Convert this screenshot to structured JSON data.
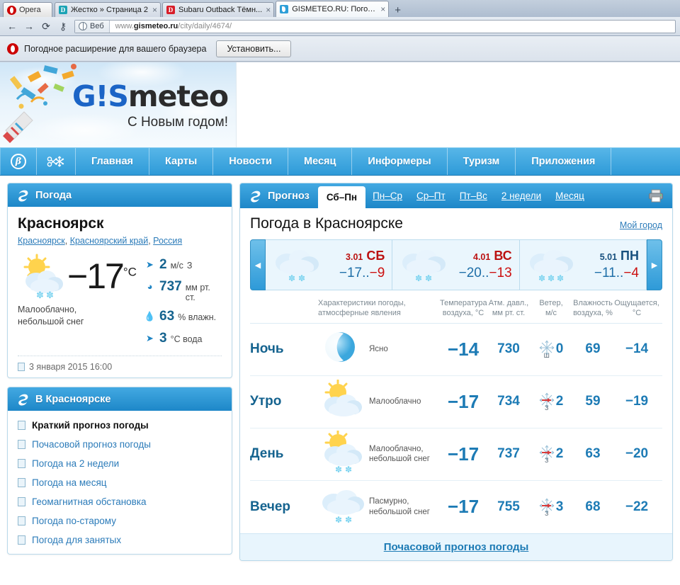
{
  "browser": {
    "opera_label": "Opera",
    "tabs": [
      {
        "title": "Жестко » Страница 2",
        "favicon": "letter-d-teal",
        "active": false
      },
      {
        "title": "Subaru Outback Тёмн...",
        "favicon": "letter-d-red",
        "active": false
      },
      {
        "title": "GISMETEO.RU: Погода ...",
        "favicon": "gismeteo-drop",
        "active": true
      }
    ],
    "new_tab_label": "+",
    "toolbar": {
      "back_icon": "arrow-left-icon",
      "forward_icon": "arrow-right-icon",
      "reload_icon": "reload-icon",
      "key_icon": "key-icon",
      "scope_label": "Веб",
      "scope_icon": "globe-icon",
      "url_prefix": "www.",
      "url_domain": "gismeteo.ru",
      "url_path": "/city/daily/4674/"
    }
  },
  "notification": {
    "icon": "opera-logo-icon",
    "text": "Погодное расширение для вашего браузера",
    "button_label": "Установить..."
  },
  "site": {
    "logo_g": "G",
    "logo_bang": "!",
    "logo_s": "S",
    "logo_rest": "meteo",
    "logo_tagline": "С Новым годом!",
    "nav": [
      {
        "label": "β",
        "type": "icon",
        "name": "beta-badge"
      },
      {
        "label": "",
        "type": "icon",
        "name": "snow-scissors"
      },
      {
        "label": "Главная",
        "type": "text"
      },
      {
        "label": "Карты",
        "type": "text"
      },
      {
        "label": "Новости",
        "type": "text"
      },
      {
        "label": "Месяц",
        "type": "text"
      },
      {
        "label": "Информеры",
        "type": "text"
      },
      {
        "label": "Туризм",
        "type": "text"
      },
      {
        "label": "Приложения",
        "type": "text"
      }
    ]
  },
  "current": {
    "panel_title": "Погода",
    "city": "Красноярск",
    "geo": [
      "Красноярск",
      "Красноярский край",
      "Россия"
    ],
    "temperature": "−17",
    "temp_unit": "°С",
    "condition": "Малооблачно,\nнебольшой снег",
    "condition_line1": "Малооблачно,",
    "condition_line2": "небольшой снег",
    "sky_icon": "sun-behind-cloud-snow-icon",
    "stats": [
      {
        "icon": "wind-arrow-icon",
        "value": "2",
        "unit": "м/с",
        "extra": "З"
      },
      {
        "icon": "barometer-icon",
        "value": "737",
        "unit": "мм рт. ст.",
        "extra": ""
      },
      {
        "icon": "droplet-icon",
        "value": "63",
        "unit": "% влажн.",
        "extra": ""
      },
      {
        "icon": "fish-icon",
        "value": "3",
        "unit": "°С вода",
        "extra": ""
      }
    ],
    "updated": "3 января 2015 16:00"
  },
  "links_panel": {
    "title": "В Красноярске",
    "items": [
      {
        "label": "Краткий прогноз погоды",
        "current": true
      },
      {
        "label": "Почасовой прогноз погоды",
        "current": false
      },
      {
        "label": "Погода на 2 недели",
        "current": false
      },
      {
        "label": "Погода на месяц",
        "current": false
      },
      {
        "label": "Геомагнитная обстановка",
        "current": false
      },
      {
        "label": "Погода по-старому",
        "current": false
      },
      {
        "label": "Погода для занятых",
        "current": false
      }
    ]
  },
  "forecast": {
    "panel_title": "Прогноз",
    "tabs": [
      {
        "label": "Сб–Пн",
        "active": true
      },
      {
        "label": "Пн–Ср",
        "active": false
      },
      {
        "label": "Ср–Пт",
        "active": false
      },
      {
        "label": "Пт–Вс",
        "active": false
      },
      {
        "label": "2 недели",
        "active": false
      },
      {
        "label": "Месяц",
        "active": false
      }
    ],
    "print_icon": "printer-icon",
    "title": "Погода в Красноярске",
    "my_city_label": "Мой город",
    "prev_arrow": "◀",
    "next_arrow": "▶",
    "days": [
      {
        "date": "3.01",
        "weekday": "СБ",
        "weekend": true,
        "low": "−17",
        "high": "−9",
        "selected": true,
        "icon": "cloud-snow-icon"
      },
      {
        "date": "4.01",
        "weekday": "ВС",
        "weekend": true,
        "low": "−20",
        "high": "−13",
        "selected": false,
        "icon": "cloud-snow-icon"
      },
      {
        "date": "5.01",
        "weekday": "ПН",
        "weekend": false,
        "low": "−11",
        "high": "−4",
        "selected": false,
        "icon": "cloud-snow-icon"
      }
    ],
    "columns": {
      "desc_l1": "Характеристики погоды,",
      "desc_l2": "атмосферные явления",
      "temp_l1": "Температура",
      "temp_l2": "воздуха, °С",
      "press_l1": "Атм. давл.,",
      "press_l2": "мм рт. ст.",
      "wind_l1": "Ветер,",
      "wind_l2": "м/с",
      "hum_l1": "Влажность",
      "hum_l2": "воздуха, %",
      "feel_l1": "Ощущается,",
      "feel_l2": "°С"
    },
    "rows": [
      {
        "part": "Ночь",
        "icon": "moon-clear-icon",
        "desc_l1": "Ясно",
        "desc_l2": "",
        "temp": "−14",
        "pressure": "730",
        "wind_dir": "Ш",
        "wind_speed": "0",
        "humidity": "69",
        "feels": "−14"
      },
      {
        "part": "Утро",
        "icon": "sun-behind-cloud-icon",
        "desc_l1": "Малооблачно",
        "desc_l2": "",
        "temp": "−17",
        "pressure": "734",
        "wind_dir": "З",
        "wind_speed": "2",
        "humidity": "59",
        "feels": "−19"
      },
      {
        "part": "День",
        "icon": "sun-behind-cloud-snow-icon",
        "desc_l1": "Малооблачно,",
        "desc_l2": "небольшой снег",
        "temp": "−17",
        "pressure": "737",
        "wind_dir": "З",
        "wind_speed": "2",
        "humidity": "63",
        "feels": "−20"
      },
      {
        "part": "Вечер",
        "icon": "cloud-snow-icon",
        "desc_l1": "Пасмурно,",
        "desc_l2": "небольшой снег",
        "temp": "−17",
        "pressure": "755",
        "wind_dir": "З",
        "wind_speed": "3",
        "humidity": "68",
        "feels": "−22"
      }
    ],
    "footer_link": "Почасовой прогноз погоды"
  },
  "colors": {
    "nav_blue": "#2e9ad8",
    "panel_header": "#1d87c8",
    "link_blue": "#2b7bb9",
    "value_blue": "#1d7bb5",
    "weekend_red": "#bb1111",
    "warm_red": "#cc1111"
  }
}
